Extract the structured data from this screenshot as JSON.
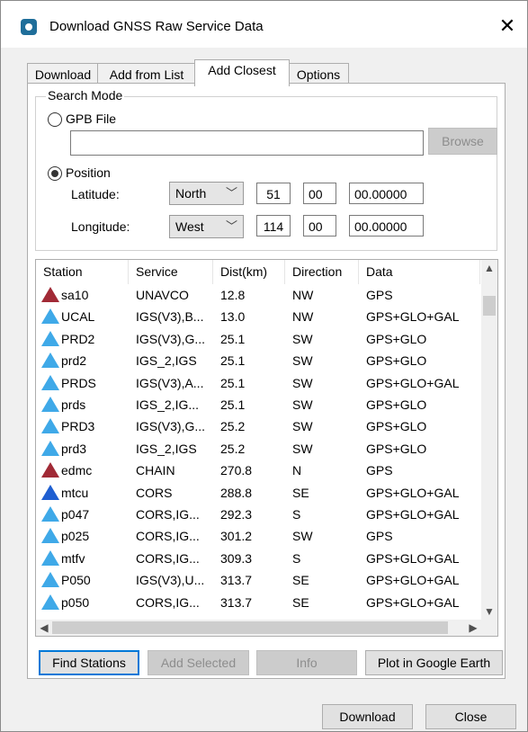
{
  "window": {
    "title": "Download GNSS Raw Service Data",
    "close_glyph": "✕"
  },
  "tabs": [
    {
      "label": "Download"
    },
    {
      "label": "Add from List"
    },
    {
      "label": "Add Closest"
    },
    {
      "label": "Options"
    }
  ],
  "search_mode": {
    "legend": "Search Mode",
    "gpb_file_label": "GPB File",
    "gpb_file_value": "",
    "browse_label": "Browse",
    "position_label": "Position",
    "latitude_label": "Latitude:",
    "latitude_hemisphere": "North",
    "latitude_deg": "51",
    "latitude_min": "00",
    "latitude_sec": "00.00000",
    "longitude_label": "Longitude:",
    "longitude_hemisphere": "West",
    "longitude_deg": "114",
    "longitude_min": "00",
    "longitude_sec": "00.00000"
  },
  "table": {
    "columns": [
      "Station",
      "Service",
      "Dist(km)",
      "Direction",
      "Data"
    ],
    "rows": [
      {
        "station": "sa10",
        "service": "UNAVCO",
        "dist": "12.8",
        "direction": "NW",
        "data": "GPS",
        "marker": "red"
      },
      {
        "station": "UCAL",
        "service": "IGS(V3),B...",
        "dist": "13.0",
        "direction": "NW",
        "data": "GPS+GLO+GAL",
        "marker": "lightblue"
      },
      {
        "station": "PRD2",
        "service": "IGS(V3),G...",
        "dist": "25.1",
        "direction": "SW",
        "data": "GPS+GLO",
        "marker": "lightblue"
      },
      {
        "station": "prd2",
        "service": "IGS_2,IGS",
        "dist": "25.1",
        "direction": "SW",
        "data": "GPS+GLO",
        "marker": "lightblue"
      },
      {
        "station": "PRDS",
        "service": "IGS(V3),A...",
        "dist": "25.1",
        "direction": "SW",
        "data": "GPS+GLO+GAL",
        "marker": "lightblue"
      },
      {
        "station": "prds",
        "service": "IGS_2,IG...",
        "dist": "25.1",
        "direction": "SW",
        "data": "GPS+GLO",
        "marker": "lightblue"
      },
      {
        "station": "PRD3",
        "service": "IGS(V3),G...",
        "dist": "25.2",
        "direction": "SW",
        "data": "GPS+GLO",
        "marker": "lightblue"
      },
      {
        "station": "prd3",
        "service": "IGS_2,IGS",
        "dist": "25.2",
        "direction": "SW",
        "data": "GPS+GLO",
        "marker": "lightblue"
      },
      {
        "station": "edmc",
        "service": "CHAIN",
        "dist": "270.8",
        "direction": "N",
        "data": "GPS",
        "marker": "red"
      },
      {
        "station": "mtcu",
        "service": "CORS",
        "dist": "288.8",
        "direction": "SE",
        "data": "GPS+GLO+GAL",
        "marker": "blue"
      },
      {
        "station": "p047",
        "service": "CORS,IG...",
        "dist": "292.3",
        "direction": "S",
        "data": "GPS+GLO+GAL",
        "marker": "lightblue"
      },
      {
        "station": "p025",
        "service": "CORS,IG...",
        "dist": "301.2",
        "direction": "SW",
        "data": "GPS",
        "marker": "lightblue"
      },
      {
        "station": "mtfv",
        "service": "CORS,IG...",
        "dist": "309.3",
        "direction": "S",
        "data": "GPS+GLO+GAL",
        "marker": "lightblue"
      },
      {
        "station": "P050",
        "service": "IGS(V3),U...",
        "dist": "313.7",
        "direction": "SE",
        "data": "GPS+GLO+GAL",
        "marker": "lightblue"
      },
      {
        "station": "p050",
        "service": "CORS,IG...",
        "dist": "313.7",
        "direction": "SE",
        "data": "GPS+GLO+GAL",
        "marker": "lightblue"
      }
    ]
  },
  "buttons": {
    "find_stations": "Find Stations",
    "add_selected": "Add Selected",
    "info": "Info",
    "plot_google_earth": "Plot in Google Earth",
    "download": "Download",
    "close": "Close"
  },
  "colors": {
    "red_marker": "#a12a36",
    "lightblue_marker": "#3fa9e8",
    "blue_marker": "#1f5fd1",
    "focus_border": "#0078d7"
  }
}
